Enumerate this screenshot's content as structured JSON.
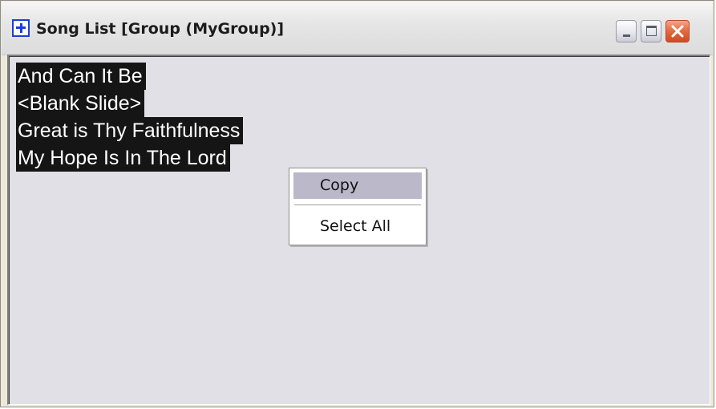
{
  "window": {
    "title": "Song List [Group (MyGroup)]",
    "icon": "plus-cross-icon",
    "controls": {
      "minimize": "minimize-icon",
      "maximize": "maximize-icon",
      "close": "close-icon"
    }
  },
  "songs": [
    "And Can It Be",
    "<Blank Slide>",
    "Great is Thy Faithfulness",
    "My Hope Is In The Lord"
  ],
  "context_menu": {
    "items": [
      "Copy",
      "Select All"
    ],
    "highlighted_item": "Copy"
  },
  "colors": {
    "selection_bg": "#151515",
    "selection_text": "#ffffff",
    "list_bg": "#e1e0e6",
    "menu_highlight": "#bab8c9",
    "close_button": "#e2693e",
    "icon_blue": "#1a3fd6"
  }
}
